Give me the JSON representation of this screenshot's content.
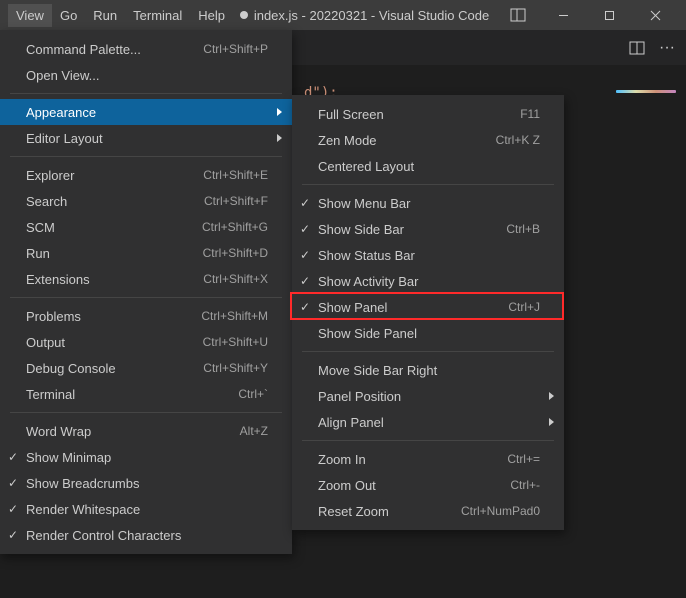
{
  "menubar": [
    "View",
    "Go",
    "Run",
    "Terminal",
    "Help"
  ],
  "title": "index.js - 20220321 - Visual Studio Code",
  "editor_token": "d\");",
  "view_menu": {
    "groups": [
      [
        {
          "label": "Command Palette...",
          "shortcut": "Ctrl+Shift+P"
        },
        {
          "label": "Open View..."
        }
      ],
      [
        {
          "label": "Appearance",
          "submenu": true,
          "hovered": true
        },
        {
          "label": "Editor Layout",
          "submenu": true
        }
      ],
      [
        {
          "label": "Explorer",
          "shortcut": "Ctrl+Shift+E"
        },
        {
          "label": "Search",
          "shortcut": "Ctrl+Shift+F"
        },
        {
          "label": "SCM",
          "shortcut": "Ctrl+Shift+G"
        },
        {
          "label": "Run",
          "shortcut": "Ctrl+Shift+D"
        },
        {
          "label": "Extensions",
          "shortcut": "Ctrl+Shift+X"
        }
      ],
      [
        {
          "label": "Problems",
          "shortcut": "Ctrl+Shift+M"
        },
        {
          "label": "Output",
          "shortcut": "Ctrl+Shift+U"
        },
        {
          "label": "Debug Console",
          "shortcut": "Ctrl+Shift+Y"
        },
        {
          "label": "Terminal",
          "shortcut": "Ctrl+`"
        }
      ],
      [
        {
          "label": "Word Wrap",
          "shortcut": "Alt+Z"
        },
        {
          "label": "Show Minimap",
          "checked": true
        },
        {
          "label": "Show Breadcrumbs",
          "checked": true
        },
        {
          "label": "Render Whitespace",
          "checked": true
        },
        {
          "label": "Render Control Characters",
          "checked": true
        }
      ]
    ]
  },
  "appearance_menu": {
    "groups": [
      [
        {
          "label": "Full Screen",
          "shortcut": "F11"
        },
        {
          "label": "Zen Mode",
          "shortcut": "Ctrl+K Z"
        },
        {
          "label": "Centered Layout"
        }
      ],
      [
        {
          "label": "Show Menu Bar",
          "checked": true
        },
        {
          "label": "Show Side Bar",
          "shortcut": "Ctrl+B",
          "checked": true
        },
        {
          "label": "Show Status Bar",
          "checked": true
        },
        {
          "label": "Show Activity Bar",
          "checked": true
        },
        {
          "label": "Show Panel",
          "shortcut": "Ctrl+J",
          "checked": true,
          "highlight": true
        },
        {
          "label": "Show Side Panel"
        }
      ],
      [
        {
          "label": "Move Side Bar Right"
        },
        {
          "label": "Panel Position",
          "submenu": true
        },
        {
          "label": "Align Panel",
          "submenu": true
        }
      ],
      [
        {
          "label": "Zoom In",
          "shortcut": "Ctrl+="
        },
        {
          "label": "Zoom Out",
          "shortcut": "Ctrl+-"
        },
        {
          "label": "Reset Zoom",
          "shortcut": "Ctrl+NumPad0"
        }
      ]
    ]
  }
}
